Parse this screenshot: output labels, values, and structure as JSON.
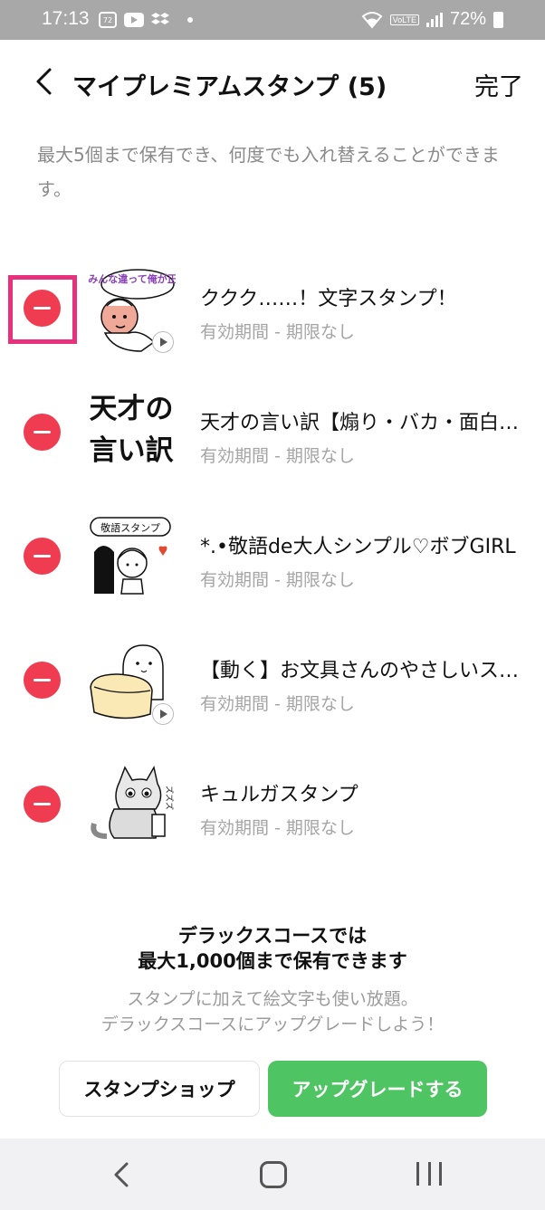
{
  "status_bar": {
    "time": "17:13",
    "badge": "72",
    "battery": "72%",
    "volte": "VoLTE"
  },
  "header": {
    "title": "マイプレミアムスタンプ (5)",
    "done_label": "完了"
  },
  "description": "最大5個まで保有でき、何度でも入れ替えることができます。",
  "stamps": [
    {
      "title": "ククク……！文字スタンプ！",
      "subtitle": "有効期間 - 期限なし",
      "thumb_text": "みんな違って俺が正解"
    },
    {
      "title": "天才の言い訳【煽り・バカ・面白い】",
      "subtitle": "有効期間 - 期限なし",
      "thumb_line1": "天才の",
      "thumb_line2": "言い訳"
    },
    {
      "title": "*.•敬語de大人シンプル♡ボブGIRL",
      "subtitle": "有効期間 - 期限なし",
      "thumb_text": "敬語スタンプ"
    },
    {
      "title": "【動く】お文具さんのやさしいスタンプ",
      "subtitle": "有効期間 - 期限なし"
    },
    {
      "title": "キュルガスタンプ",
      "subtitle": "有効期間 - 期限なし",
      "thumb_text": "ズズズ"
    }
  ],
  "promo": {
    "headline_line1": "デラックスコースでは",
    "headline_line2": "最大1,000個まで保有できます",
    "sub_line1": "スタンプに加えて絵文字も使い放題。",
    "sub_line2": "デラックスコースにアップグレードしよう！"
  },
  "buttons": {
    "shop_label": "スタンプショップ",
    "upgrade_label": "アップグレードする"
  },
  "colors": {
    "remove": "#f03c50",
    "highlight": "#e8317a",
    "upgrade": "#4ec463"
  }
}
